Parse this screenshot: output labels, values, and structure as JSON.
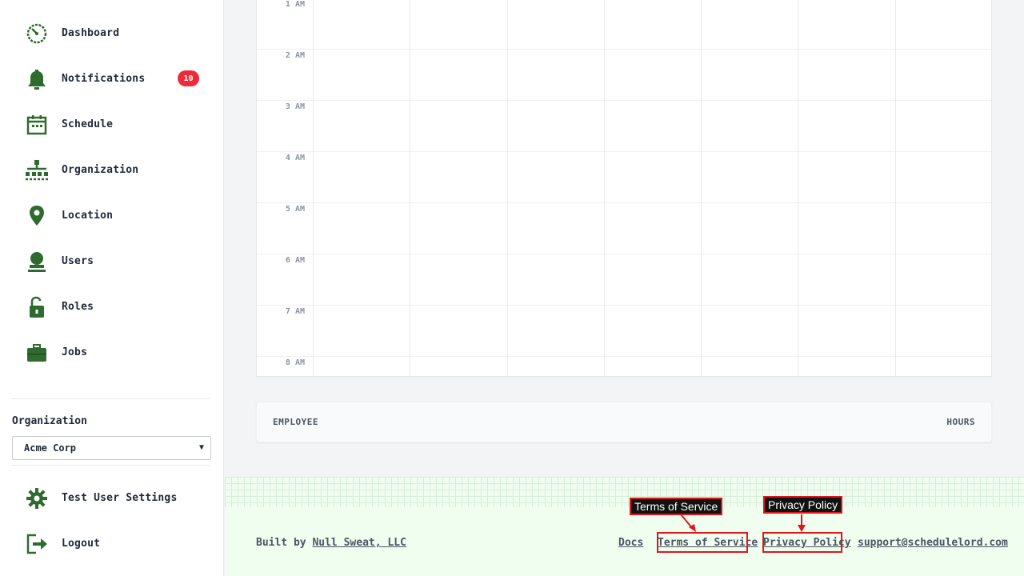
{
  "sidebar": {
    "items": [
      {
        "label": "Dashboard",
        "icon": "dashboard-icon"
      },
      {
        "label": "Notifications",
        "icon": "bell-icon",
        "badge": "10"
      },
      {
        "label": "Schedule",
        "icon": "calendar-icon"
      },
      {
        "label": "Organization",
        "icon": "org-chart-icon"
      },
      {
        "label": "Location",
        "icon": "location-pin-icon"
      },
      {
        "label": "Users",
        "icon": "user-icon"
      },
      {
        "label": "Roles",
        "icon": "unlock-icon"
      },
      {
        "label": "Jobs",
        "icon": "briefcase-icon"
      }
    ],
    "organization_label": "Organization",
    "organization_selected": "Acme Corp",
    "settings_label": "Test User Settings",
    "logout_label": "Logout"
  },
  "calendar": {
    "hours": [
      "1 AM",
      "2 AM",
      "3 AM",
      "4 AM",
      "5 AM",
      "6 AM",
      "7 AM",
      "8 AM"
    ]
  },
  "employee_table": {
    "col_employee": "EMPLOYEE",
    "col_hours": "HOURS"
  },
  "footer": {
    "built_by_prefix": "Built by",
    "built_by_link": "Null Sweat, LLC",
    "docs": "Docs",
    "terms": "Terms of Service",
    "privacy": "Privacy Policy",
    "email": "support@schedulelord.com"
  },
  "annotations": {
    "terms_tip": "Terms of Service",
    "privacy_tip": "Privacy Policy"
  },
  "colors": {
    "icon_green": "#2f6b2f",
    "badge_red": "#ef2b39",
    "highlight_red": "#e0161b"
  }
}
